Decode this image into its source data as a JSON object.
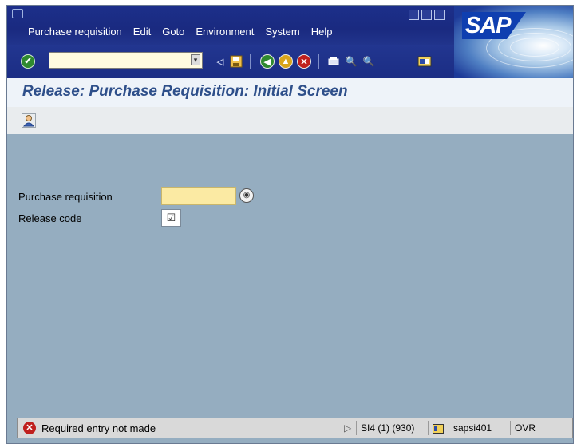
{
  "menubar": {
    "items": [
      "Purchase requisition",
      "Edit",
      "Goto",
      "Environment",
      "System",
      "Help"
    ],
    "logo": "SAP"
  },
  "toolbar": {
    "command_field_value": "",
    "icons": [
      "enter-icon",
      "save-icon",
      "back-icon",
      "exit-icon",
      "cancel-icon",
      "print-icon",
      "find-icon",
      "find-next-icon",
      "layout-icon"
    ]
  },
  "screen": {
    "title": "Release: Purchase Requisition: Initial Screen"
  },
  "form": {
    "purchase_requisition_label": "Purchase requisition",
    "purchase_requisition_value": "",
    "release_code_label": "Release code",
    "release_code_checked": true
  },
  "statusbar": {
    "message": "Required entry not made",
    "system": "SI4 (1) (930)",
    "server": "sapsi401",
    "mode": "OVR"
  },
  "colors": {
    "menubar": "#1c2f8a",
    "workarea": "#95adc0",
    "title_text": "#2e4f8a",
    "required_field": "#fbeaa3",
    "error": "#c0201e"
  }
}
